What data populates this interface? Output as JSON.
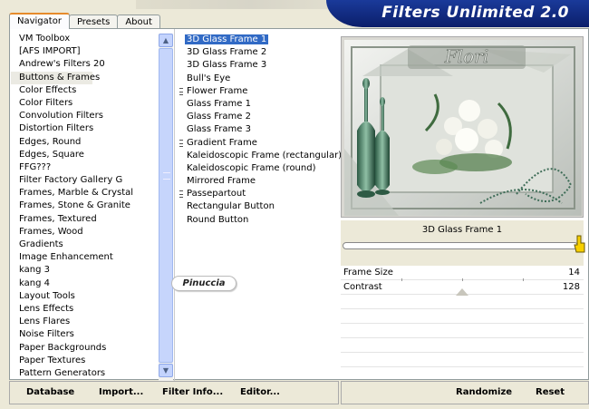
{
  "window": {
    "title": "Filters Unlimited 2.0"
  },
  "tabs": [
    {
      "label": "Navigator",
      "active": true
    },
    {
      "label": "Presets",
      "active": false
    },
    {
      "label": "About",
      "active": false
    }
  ],
  "categories": {
    "selected": "Buttons & Frames",
    "items": [
      "VM Toolbox",
      "[AFS IMPORT]",
      "Andrew's Filters 20",
      "Buttons & Frames",
      "Color Effects",
      "Color Filters",
      "Convolution Filters",
      "Distortion Filters",
      "Edges, Round",
      "Edges, Square",
      "FFG???",
      "Filter Factory Gallery G",
      "Frames, Marble & Crystal",
      "Frames, Stone & Granite",
      "Frames, Textured",
      "Frames, Wood",
      "Gradients",
      "Image Enhancement",
      "kang 3",
      "kang 4",
      "Layout Tools",
      "Lens Effects",
      "Lens Flares",
      "Noise Filters",
      "Paper Backgrounds",
      "Paper Textures",
      "Pattern Generators"
    ]
  },
  "filters": {
    "selected": "3D Glass Frame 1",
    "items": [
      {
        "label": "3D Glass Frame 1",
        "group": false
      },
      {
        "label": "3D Glass Frame 2",
        "group": false
      },
      {
        "label": "3D Glass Frame 3",
        "group": false
      },
      {
        "label": "Bull's Eye",
        "group": false
      },
      {
        "label": "Flower Frame",
        "group": true
      },
      {
        "label": "Glass Frame 1",
        "group": false
      },
      {
        "label": "Glass Frame 2",
        "group": false
      },
      {
        "label": "Glass Frame 3",
        "group": false
      },
      {
        "label": "Gradient Frame",
        "group": true
      },
      {
        "label": "Kaleidoscopic Frame (rectangular)",
        "group": false
      },
      {
        "label": "Kaleidoscopic Frame (round)",
        "group": false
      },
      {
        "label": "Mirrored Frame",
        "group": false
      },
      {
        "label": "Passepartout",
        "group": true
      },
      {
        "label": "Rectangular Button",
        "group": false
      },
      {
        "label": "Round Button",
        "group": false
      }
    ]
  },
  "watermark": {
    "text": "Pinuccia"
  },
  "preview": {
    "overlay_text": "Flori"
  },
  "params": {
    "filter_name": "3D Glass Frame 1",
    "rows": [
      {
        "label": "Frame Size",
        "value": "14"
      },
      {
        "label": "Contrast",
        "value": "128"
      }
    ]
  },
  "buttons": {
    "database": "Database",
    "import": "Import...",
    "filter_info": "Filter Info...",
    "editor": "Editor...",
    "randomize": "Randomize",
    "reset": "Reset"
  },
  "colors": {
    "title_bar": "#0b1e6a",
    "selection": "#316ac5",
    "tab_accent": "#e68b2c",
    "window_bg": "#ece9d8"
  }
}
